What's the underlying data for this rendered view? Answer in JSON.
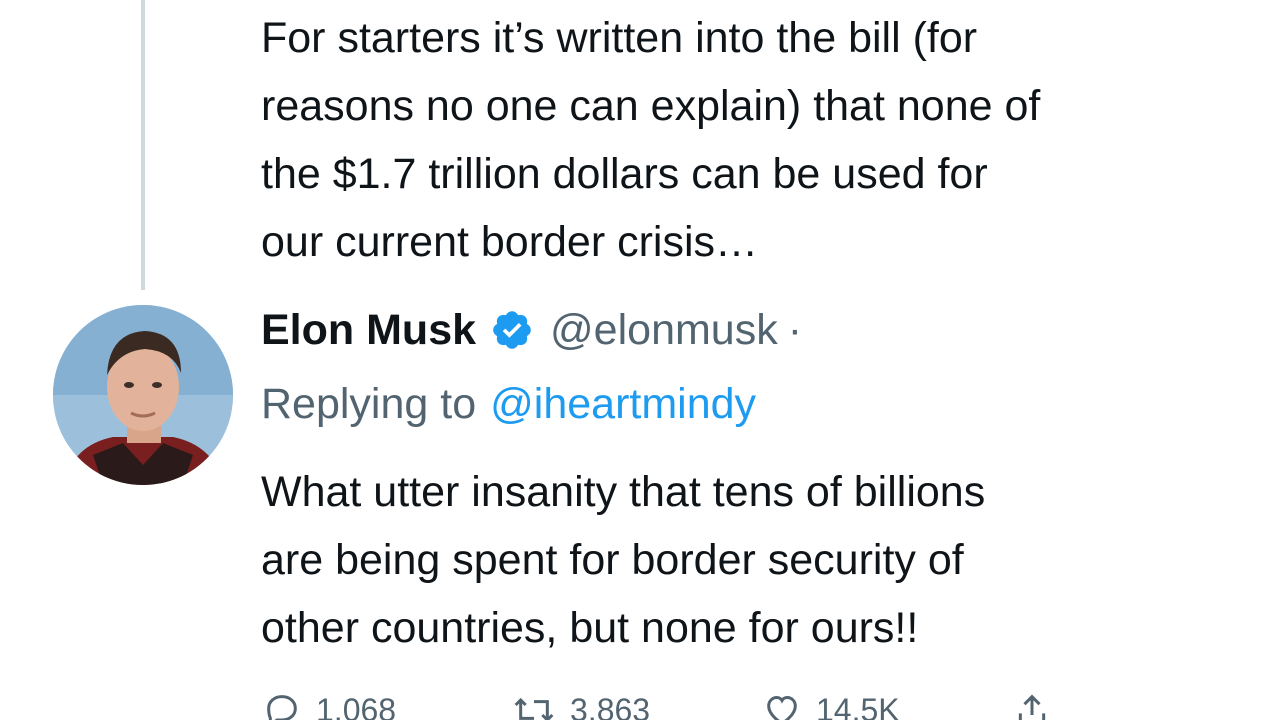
{
  "previous_tweet": {
    "text": "For starters it’s written into the bill (for\nreasons no one can explain) that none of\nthe $1.7 trillion dollars can be used for\nour current border crisis…"
  },
  "tweet": {
    "author": {
      "display_name": "Elon Musk",
      "handle": "@elonmusk",
      "separator": "·",
      "verified_icon": "verified-badge-icon",
      "verified_color": "#1d9bf0"
    },
    "reply": {
      "prefix": "Replying to",
      "mention": "@iheartmindy",
      "mention_color": "#1d9bf0"
    },
    "text": "What utter insanity that tens of billions\nare being spent for border security of\nother countries, but none for ours!!",
    "actions": {
      "replies": "1,068",
      "retweets": "3,863",
      "likes": "14.5K",
      "reply_icon": "reply-icon",
      "retweet_icon": "retweet-icon",
      "like_icon": "heart-icon",
      "share_icon": "share-icon"
    }
  }
}
